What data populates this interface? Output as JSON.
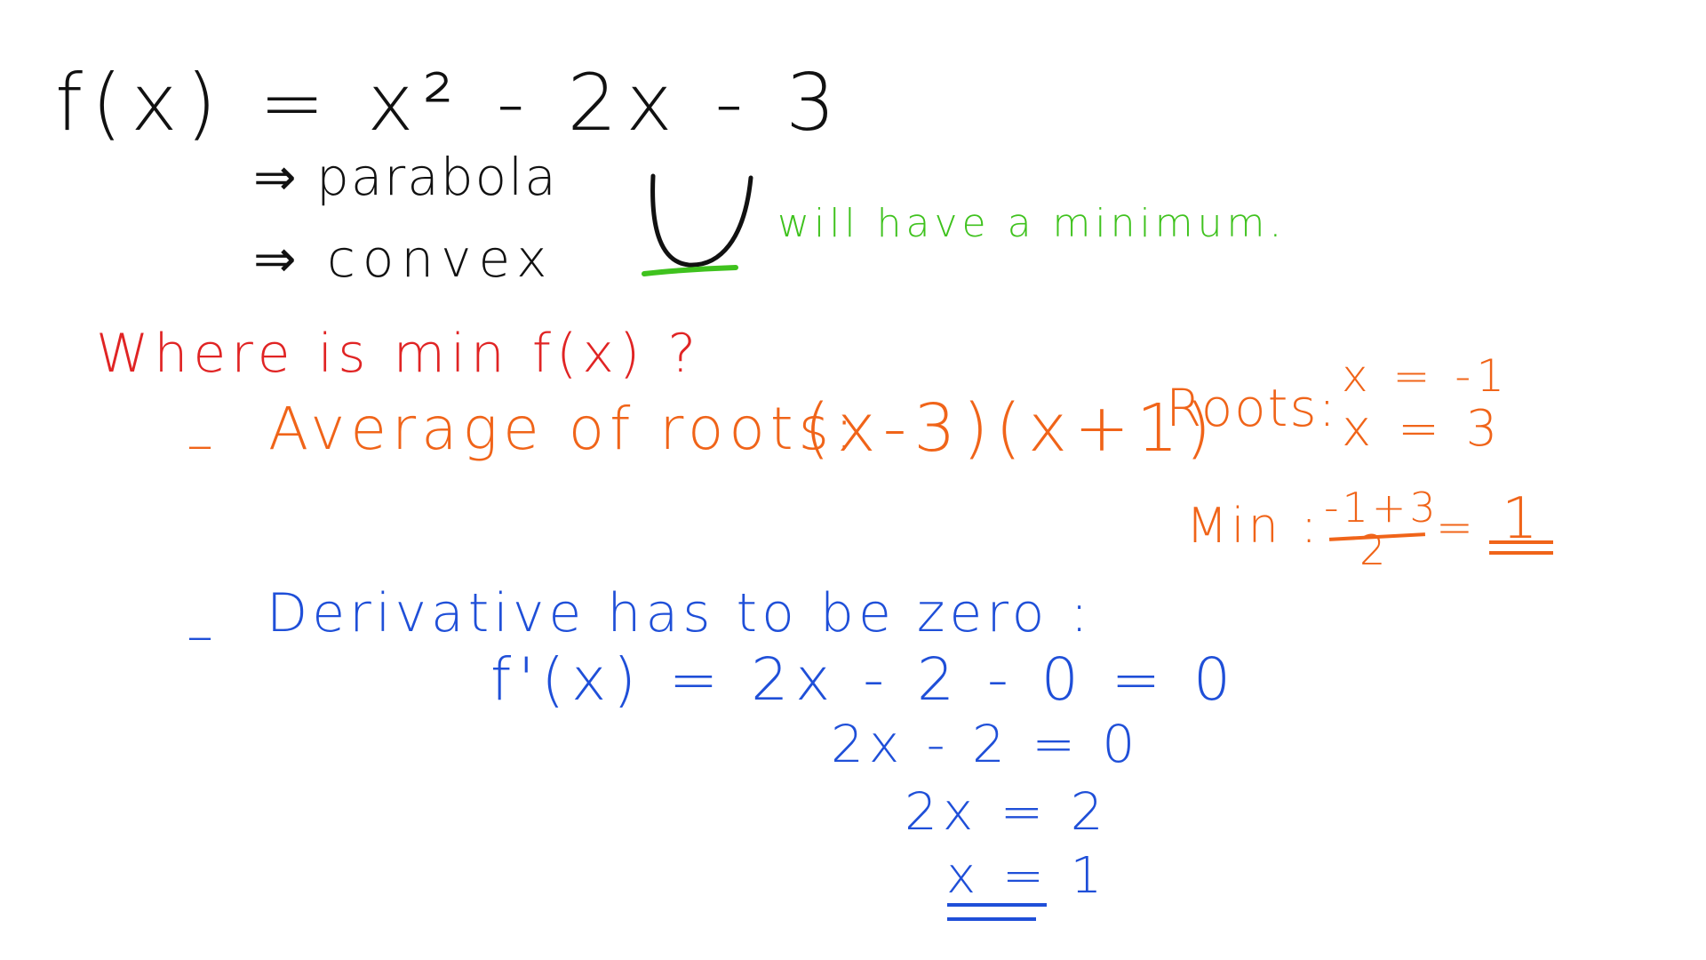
{
  "whiteboard": {
    "line_formula": "f(x) = x² - 2x - 3",
    "note_parabola": "⇒ parabola",
    "note_convex": "⇒ convex",
    "note_minimum": "will have a minimum.",
    "question": "Where is  min f(x) ?",
    "method1": {
      "dash": "–",
      "label": "Average of roots:",
      "factored": "(x-3)(x+1)",
      "roots_label": "Roots:",
      "root1": "x = -1",
      "root2": "x = 3",
      "min_label": "Min :",
      "fraction_numerator": "-1+3",
      "fraction_denominator": "2",
      "equals": "=",
      "result": "1"
    },
    "method2": {
      "dash": "–",
      "label": "Derivative has to be zero :",
      "step1": "f'(x) = 2x - 2 - 0  = 0",
      "step2": "2x - 2 = 0",
      "step3": "2x = 2",
      "step4": "x = 1"
    },
    "colors": {
      "black": "#111111",
      "green": "#3fc21e",
      "red": "#e02424",
      "orange": "#f06419",
      "blue": "#1f4fd8"
    }
  }
}
